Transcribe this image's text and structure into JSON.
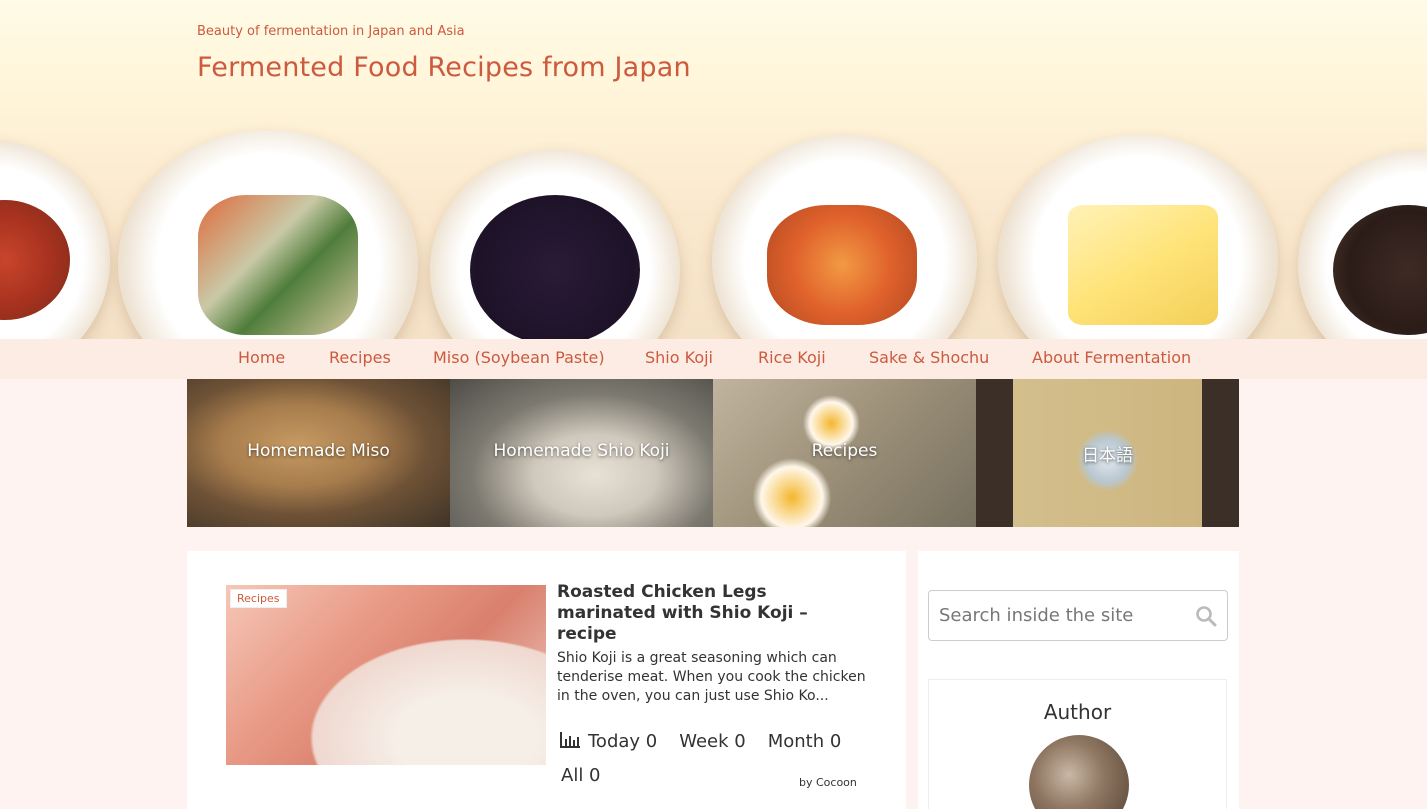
{
  "header": {
    "tagline": "Beauty of fermentation in Japan and Asia",
    "site_title": "Fermented Food Recipes from Japan"
  },
  "nav": {
    "items": [
      {
        "label": "Home"
      },
      {
        "label": "Recipes"
      },
      {
        "label": "Miso (Soybean Paste)"
      },
      {
        "label": "Shio Koji"
      },
      {
        "label": "Rice Koji"
      },
      {
        "label": "Sake & Shochu"
      },
      {
        "label": "About Fermentation"
      }
    ]
  },
  "tiles": [
    {
      "label": "Homemade Miso"
    },
    {
      "label": "Homemade Shio Koji"
    },
    {
      "label": "Recipes"
    },
    {
      "label": "日本語"
    }
  ],
  "post": {
    "category": "Recipes",
    "title": "Roasted Chicken Legs marinated with Shio Koji – recipe",
    "excerpt": "Shio Koji is a great seasoning which can tenderise meat. When you cook the chicken in the oven, you can just use Shio Ko...",
    "stats": {
      "today": "Today 0",
      "week": "Week 0",
      "month": "Month 0",
      "all": "All 0"
    },
    "credit": "by Cocoon"
  },
  "sidebar": {
    "search_placeholder": "Search inside the site",
    "author_title": "Author"
  },
  "colors": {
    "accent": "#cc5a3e",
    "background": "#fff3f1",
    "nav_background": "#fdece4"
  }
}
